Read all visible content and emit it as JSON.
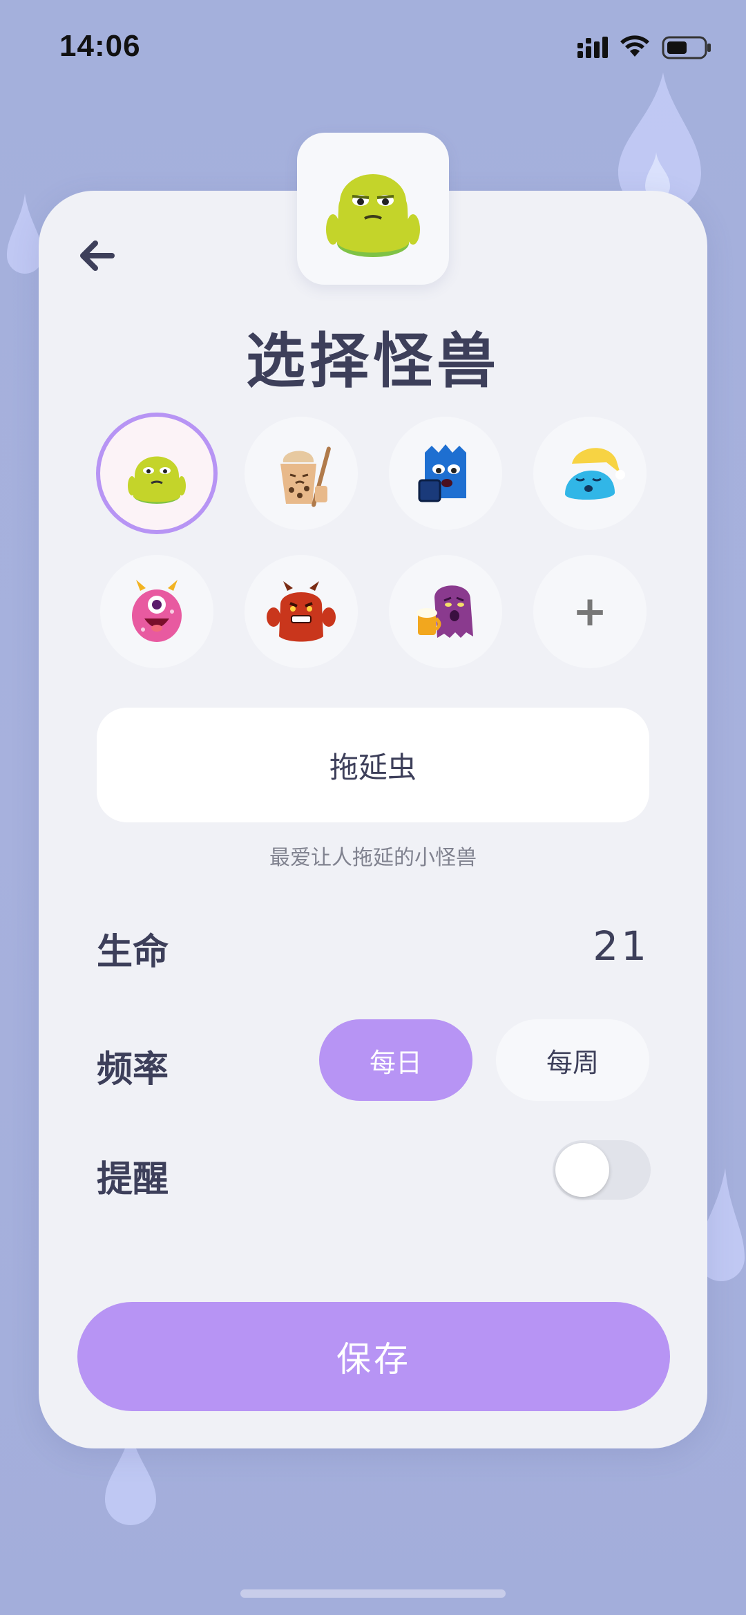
{
  "status_bar": {
    "time": "14:06"
  },
  "screen": {
    "title": "选择怪兽"
  },
  "monsters": [
    {
      "id": "procrastination-green",
      "selected": true
    },
    {
      "id": "milk-tea-monster",
      "selected": false
    },
    {
      "id": "phone-monster",
      "selected": false
    },
    {
      "id": "sleepy-monster",
      "selected": false
    },
    {
      "id": "pink-cyclops-monster",
      "selected": false
    },
    {
      "id": "angry-red-monster",
      "selected": false
    },
    {
      "id": "beer-monster",
      "selected": false
    }
  ],
  "add_monster_label": "+",
  "name_field": {
    "value": "拖延虫"
  },
  "description": "最爱让人拖延的小怪兽",
  "life": {
    "label": "生命",
    "value": "21"
  },
  "frequency": {
    "label": "频率",
    "options": [
      "每日",
      "每周"
    ],
    "selected": "每日"
  },
  "reminder": {
    "label": "提醒",
    "enabled": false
  },
  "save_label": "保存",
  "colors": {
    "accent": "#b794f4",
    "background": "#a4b0dc",
    "card": "#f0f1f6",
    "text": "#3d3f5a"
  }
}
